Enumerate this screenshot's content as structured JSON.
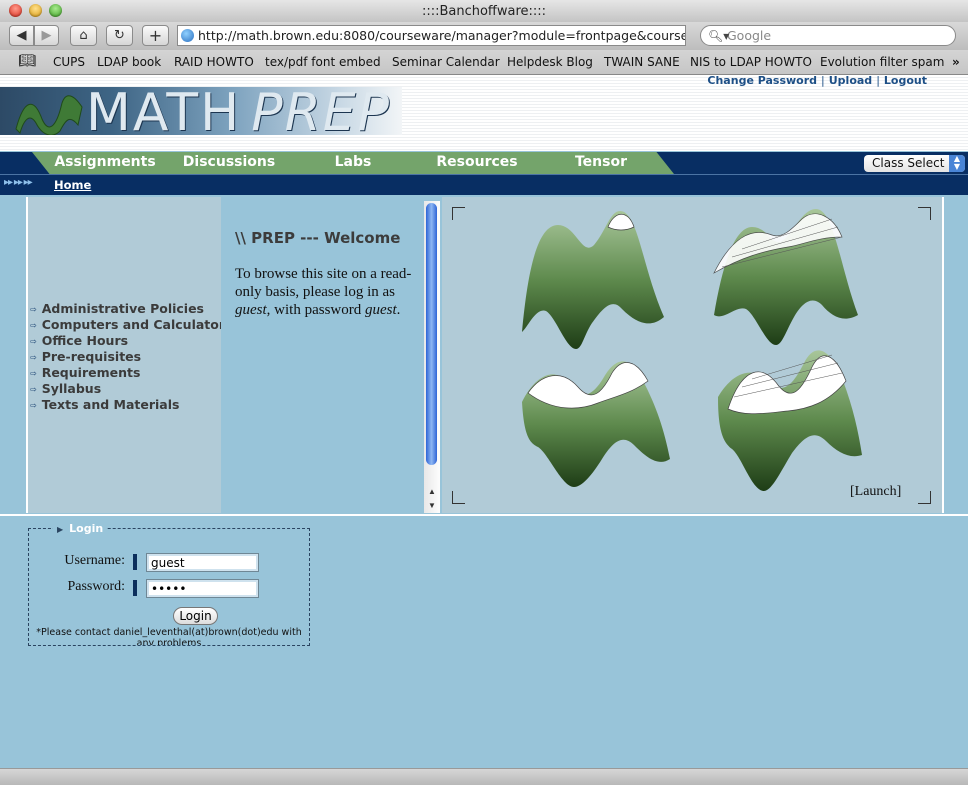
{
  "window": {
    "title": "::::Banchoffware::::"
  },
  "toolbar": {
    "url": "http://math.brown.edu:8080/courseware/manager?module=frontpage&course=pr",
    "search_placeholder": "Google"
  },
  "bookmarks": [
    "CUPS",
    "LDAP book",
    "RAID HOWTO",
    "tex/pdf font embed",
    "Seminar Calendar",
    "Helpdesk Blog",
    "TWAIN SANE",
    "NIS to LDAP HOWTO",
    "Evolution filter spam"
  ],
  "header": {
    "logo_text_1": "MATH",
    "logo_text_2": "PREP",
    "links": [
      "Change Password",
      "Upload",
      "Logout"
    ]
  },
  "nav": {
    "tabs": [
      "Assignments",
      "Discussions",
      "Labs",
      "Resources",
      "Tensor"
    ],
    "class_select": "Class Select",
    "breadcrumb": "Home"
  },
  "sidebar": {
    "items": [
      "Administrative Policies",
      "Computers and Calculators",
      "Office Hours",
      "Pre-requisites",
      "Requirements",
      "Syllabus",
      "Texts and Materials"
    ]
  },
  "welcome": {
    "heading": "\\\\ PREP --- Welcome",
    "text_1": "To browse this site on a read-only basis, please log in as ",
    "user": "guest",
    "text_2": ", with password ",
    "password": "guest",
    "text_3": "."
  },
  "applet": {
    "launch": "[Launch]"
  },
  "login": {
    "legend": "Login",
    "username_label": "Username:",
    "username_value": "guest",
    "password_label": "Password:",
    "password_value": "guest",
    "button": "Login",
    "note": "*Please contact daniel_leventhal(at)brown(dot)edu with any problems"
  },
  "colors": {
    "nav_bg": "#082e63",
    "tab_green": "#74a46b",
    "page_bg": "#98c4d9",
    "panel": "#b1cbd7"
  }
}
